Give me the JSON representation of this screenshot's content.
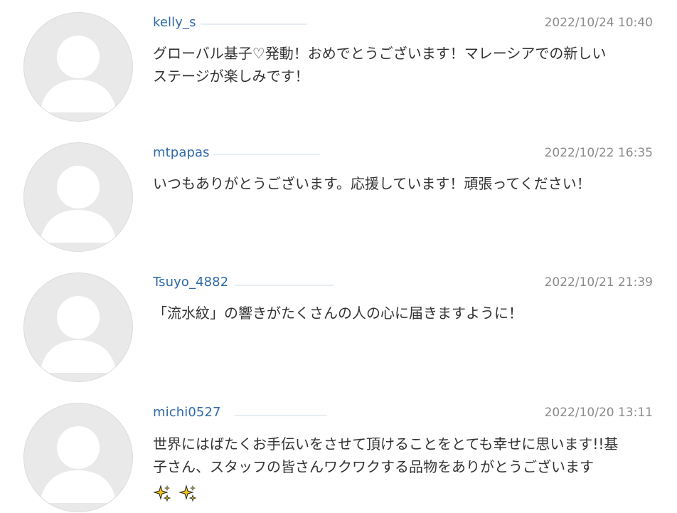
{
  "comments": [
    {
      "username": "kelly_s",
      "timestamp": "2022/10/24 10:40",
      "lines": [
        "グローバル基子♡発動！おめでとうございます！マレーシアでの新しい",
        "ステージが楽しみです！"
      ],
      "avatar_icon": "default-user-icon"
    },
    {
      "username": "mtpapas",
      "timestamp": "2022/10/22 16:35",
      "lines": [
        "いつもありがとうございます。応援しています！頑張ってください！"
      ],
      "avatar_icon": "default-user-icon"
    },
    {
      "username": "Tsuyo_4882",
      "timestamp": "2022/10/21 21:39",
      "lines": [
        "「流水紋」の響きがたくさんの人の心に届きますように！"
      ],
      "avatar_icon": "default-user-icon"
    },
    {
      "username": "michi0527",
      "timestamp": "2022/10/20 13:11",
      "lines": [
        "世界にはばたくお手伝いをさせて頂けることをとても幸せに思います!!基",
        "子さん、スタッフの皆さんワクワクする品物をありがとうございます"
      ],
      "trailing_icons": [
        "sparkles-icon",
        "sparkles-icon"
      ],
      "avatar_icon": "default-user-icon"
    }
  ],
  "colors": {
    "username": "#2f6aa8",
    "timestamp": "#8a8a8a",
    "body": "#333333",
    "avatar_bg": "#e9e9e9",
    "avatar_fg": "#ffffff",
    "sparkle": "#f0c419"
  }
}
